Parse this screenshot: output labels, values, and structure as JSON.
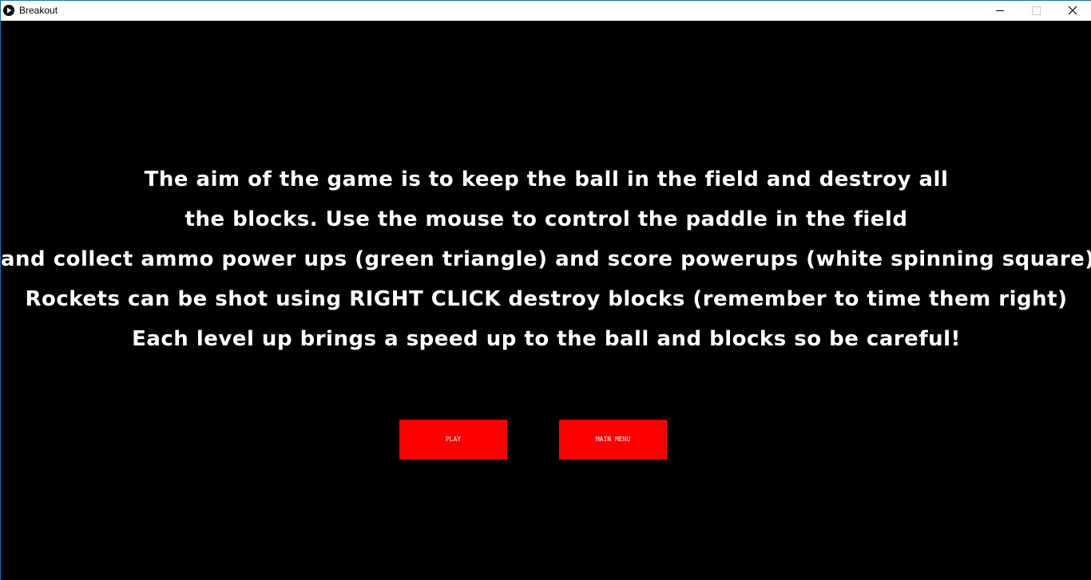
{
  "window": {
    "title": "Breakout",
    "icon": "play-circle-icon"
  },
  "controls": {
    "minimize_icon": "minimize-icon",
    "maximize_icon": "maximize-icon",
    "close_icon": "close-icon"
  },
  "instructions": [
    "The aim of the game is to keep the ball in the field and destroy all",
    "the blocks. Use the mouse to control the paddle in the field",
    "and collect ammo power ups (green triangle) and score powerups (white spinning square)",
    "Rockets can be shot using RIGHT CLICK destroy blocks (remember to time them right)",
    "Each level up brings a speed up to the ball and blocks so be careful!"
  ],
  "buttons": {
    "play_label": "PLAY",
    "main_menu_label": "MAIN MENU"
  },
  "colors": {
    "background": "#000000",
    "button": "#ff0000",
    "text": "#ffffff"
  }
}
